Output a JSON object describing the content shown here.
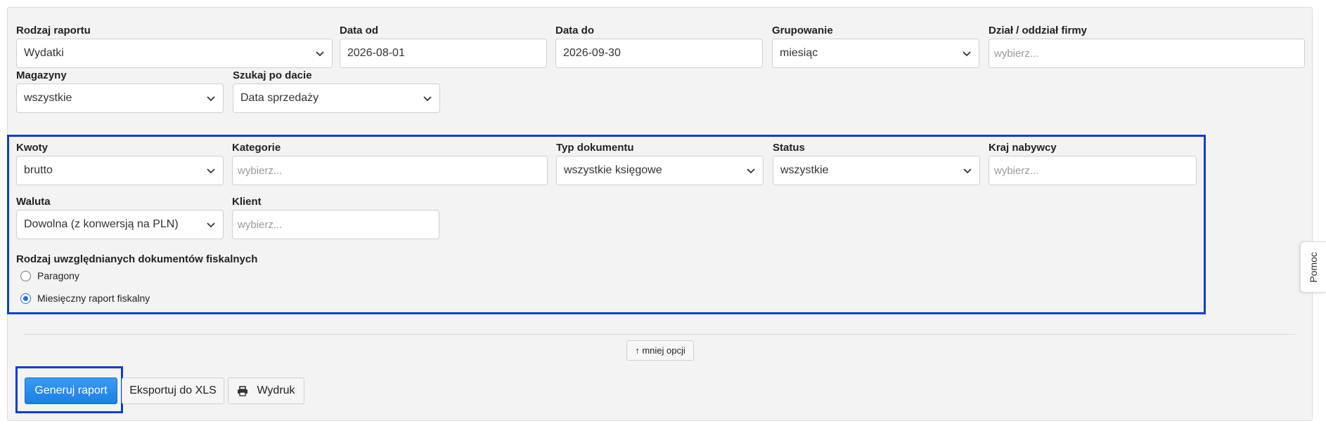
{
  "filters": {
    "report_type": {
      "label": "Rodzaj raportu",
      "value": "Wydatki"
    },
    "date_from": {
      "label": "Data od",
      "value": "2026-08-01"
    },
    "date_to": {
      "label": "Data do",
      "value": "2026-09-30"
    },
    "grouping": {
      "label": "Grupowanie",
      "value": "miesiąc"
    },
    "department": {
      "label": "Dział / oddział firmy",
      "placeholder": "wybierz..."
    },
    "warehouses": {
      "label": "Magazyny",
      "value": "wszystkie"
    },
    "search_by_date": {
      "label": "Szukaj po dacie",
      "value": "Data sprzedaży"
    }
  },
  "advanced": {
    "amounts": {
      "label": "Kwoty",
      "value": "brutto"
    },
    "categories": {
      "label": "Kategorie",
      "placeholder": "wybierz..."
    },
    "document_type": {
      "label": "Typ dokumentu",
      "value": "wszystkie księgowe"
    },
    "status": {
      "label": "Status",
      "value": "wszystkie"
    },
    "buyer_country": {
      "label": "Kraj nabywcy",
      "placeholder": "wybierz..."
    },
    "currency": {
      "label": "Waluta",
      "value": "Dowolna (z konwersją na PLN)"
    },
    "client": {
      "label": "Klient",
      "placeholder": "wybierz..."
    },
    "fiscal_docs": {
      "label": "Rodzaj uwzględnianych dokumentów fiskalnych",
      "options": [
        {
          "label": "Paragony",
          "selected": false
        },
        {
          "label": "Miesięczny raport fiskalny",
          "selected": true
        }
      ]
    }
  },
  "toggle": {
    "less_options_label": "↑ mniej opcji"
  },
  "actions": {
    "generate_label": "Generuj raport",
    "export_label": "Eksportuj do XLS",
    "print_label": "Wydruk"
  },
  "help": {
    "label": "Pomoc"
  },
  "colors": {
    "highlight_border": "#0a3fd6",
    "primary_button": "#1a7fe6",
    "panel_background": "#f3f3f3"
  }
}
